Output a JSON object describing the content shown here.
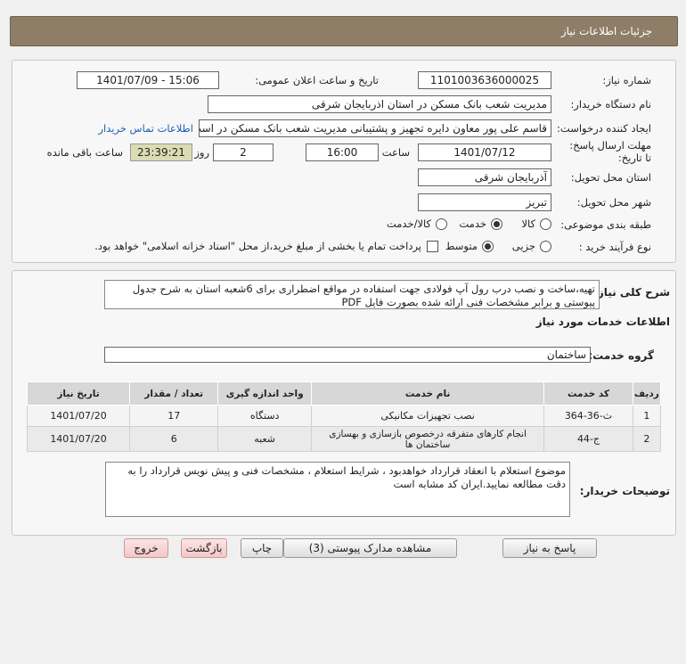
{
  "header": {
    "title": "جزئیات اطلاعات نیاز"
  },
  "form": {
    "need_number_label": "شماره نیاز:",
    "need_number": "1101003636000025",
    "announce_label": "تاریخ و ساعت اعلان عمومی:",
    "announce_value": "1401/07/09 - 15:06",
    "buyer_org_label": "نام دستگاه خریدار:",
    "buyer_org": "مدیریت شعب بانک مسکن در استان اذربایجان شرقی",
    "creator_label": "ایجاد کننده درخواست:",
    "creator": "قاسم علی پور معاون دایره تجهیز و پشتیبانی مدیریت شعب بانک مسکن در است",
    "contact_link": "اطلاعات تماس خریدار",
    "deadline_label": "مهلت ارسال پاسخ: تا تاریخ:",
    "deadline_date": "1401/07/12",
    "time_label": "ساعت",
    "deadline_time": "16:00",
    "days_value": "2",
    "days_label": "روز و",
    "remaining_time": "23:39:21",
    "remaining_label": "ساعت باقی مانده",
    "province_label": "استان محل تحویل:",
    "province": "آذربایجان شرقی",
    "city_label": "شهر محل تحویل:",
    "city": "تبریز",
    "category_label": "طبقه بندی موضوعی:",
    "category_options": [
      "کالا",
      "خدمت",
      "کالا/خدمت"
    ],
    "category_selected": 1,
    "process_label": "نوع فرآیند خرید :",
    "process_options": [
      "جزیی",
      "متوسط"
    ],
    "process_selected": 1,
    "payment_note": "پرداخت تمام یا بخشی از مبلغ خرید،از محل \"اسناد خزانه اسلامی\" خواهد بود."
  },
  "description": {
    "summary_label": "شرح کلی نیاز:",
    "summary": "تهیه،ساخت و نصب درب رول آپ فولادی جهت استفاده در مواقع اضطراری برای 6شعبه استان به شرح جدول پیوستی و برابر مشخصات فنی ارائه شده بصورت فایل PDF",
    "services_heading": "اطلاعات خدمات مورد نیاز",
    "service_group_label": "گروه خدمت:",
    "service_group": "ساختمان",
    "table": {
      "headers": [
        "ردیف",
        "کد خدمت",
        "نام خدمت",
        "واحد اندازه گیری",
        "تعداد / مقدار",
        "تاریخ نیاز"
      ],
      "rows": [
        [
          "1",
          "ث-36-364",
          "نصب تجهیزات مکانیکی",
          "دستگاه",
          "17",
          "1401/07/20"
        ],
        [
          "2",
          "ج-44",
          "انجام کارهای متفرقه درخصوص بازسازی و بهسازی ساختمان ها",
          "شعبه",
          "6",
          "1401/07/20"
        ]
      ]
    },
    "buyer_notes_label": "توضیحات خریدار:",
    "buyer_notes": "موضوع استعلام با انعقاد قرارداد خواهدبود ، شرایط استعلام ، مشخصات فنی و پیش نویس قرارداد را به دقت مطالعه نمایید.ایران کد مشابه است"
  },
  "buttons": {
    "reply": "پاسخ به نیاز",
    "attachments": "مشاهده مدارک پیوستی (3)",
    "print": "چاپ",
    "back": "بازگشت",
    "exit": "خروج"
  }
}
